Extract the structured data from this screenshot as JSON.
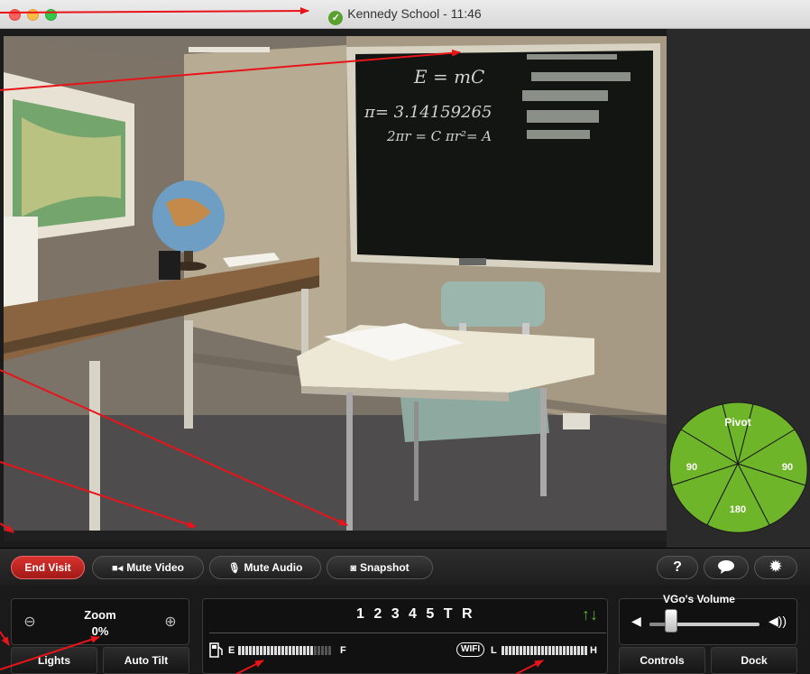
{
  "window": {
    "title": "Kennedy School - 11:46",
    "status_icon": "check-icon",
    "status_color": "#5aa02c"
  },
  "video": {
    "board_lines": [
      "E = mC",
      "π= 3.14159265",
      "2πr = C   πr²= A"
    ]
  },
  "pivot": {
    "label": "Pivot",
    "left": "90",
    "right": "90",
    "bottom": "180",
    "color": "#6fb52a"
  },
  "toolbar": {
    "end_visit": "End Visit",
    "mute_video": "Mute Video",
    "mute_audio": "Mute Audio",
    "snapshot": "Snapshot",
    "help": "?",
    "chat_icon": "chat-bubble-icon",
    "settings_icon": "gear-icon"
  },
  "zoom": {
    "label": "Zoom",
    "value": "0%",
    "out_icon": "zoom-out-icon",
    "in_icon": "zoom-in-icon"
  },
  "buttons": {
    "lights": "Lights",
    "auto_tilt": "Auto Tilt",
    "controls": "Controls",
    "dock": "Dock"
  },
  "drive": {
    "gears": "1 2 3 4 5 T R",
    "gear_arrows": "↑↓"
  },
  "battery": {
    "empty_label": "E",
    "full_label": "F",
    "level": 0.8,
    "icon": "fuel-pump-icon"
  },
  "wifi": {
    "tag": "WIFI",
    "low_label": "L",
    "high_label": "H",
    "level": 1.0
  },
  "volume": {
    "title": "VGo's Volume",
    "level": 0.2,
    "low_icon": "speaker-low-icon",
    "high_icon": "speaker-high-icon"
  }
}
